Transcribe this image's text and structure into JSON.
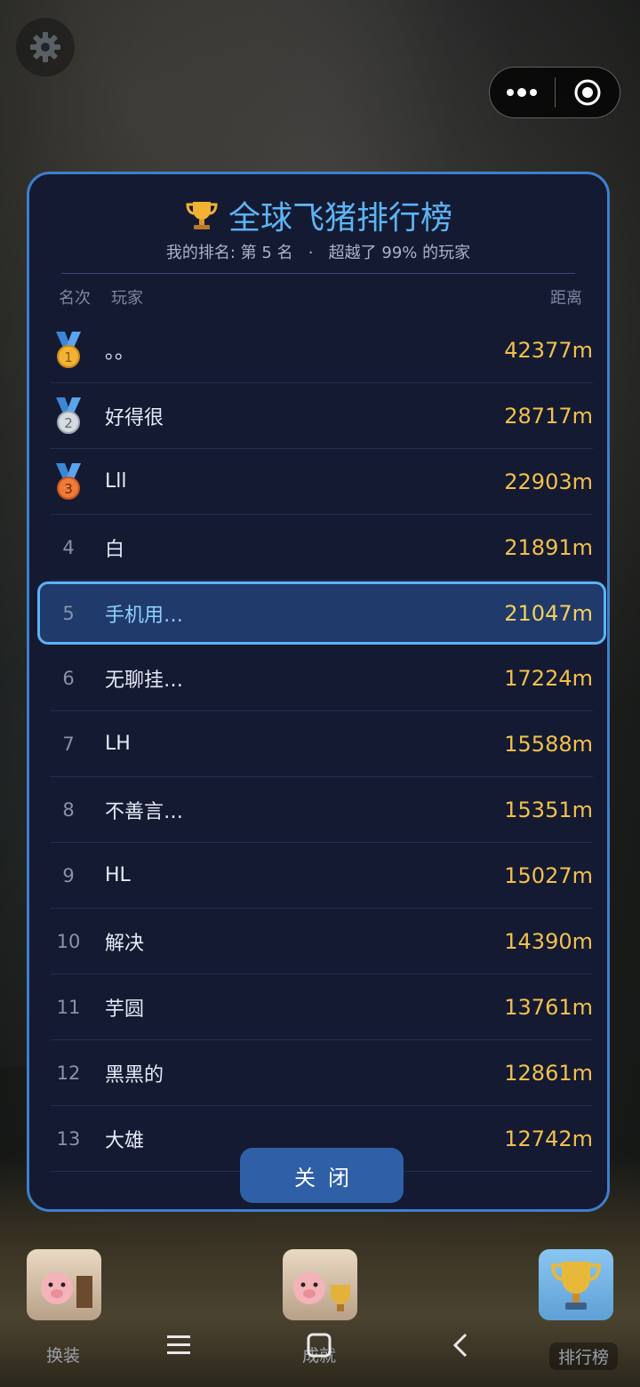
{
  "panel": {
    "title": "全球飞猪排行榜",
    "subtitle_prefix": "我的排名: 第 5 名",
    "subtitle_dot": "·",
    "subtitle_suffix": "超越了 99% 的玩家",
    "header": {
      "rank": "名次",
      "player": "玩家",
      "distance": "距离"
    },
    "rows": [
      {
        "rank": "1",
        "name": "。。",
        "distance": "42377m",
        "medal": "gold"
      },
      {
        "rank": "2",
        "name": "好得很",
        "distance": "28717m",
        "medal": "silver"
      },
      {
        "rank": "3",
        "name": "Lll",
        "distance": "22903m",
        "medal": "bronze"
      },
      {
        "rank": "4",
        "name": "白",
        "distance": "21891m"
      },
      {
        "rank": "5",
        "name": "手机用…",
        "distance": "21047m",
        "is_me": true
      },
      {
        "rank": "6",
        "name": "无聊挂…",
        "distance": "17224m"
      },
      {
        "rank": "7",
        "name": "LH",
        "distance": "15588m"
      },
      {
        "rank": "8",
        "name": "不善言…",
        "distance": "15351m"
      },
      {
        "rank": "9",
        "name": "HL",
        "distance": "15027m"
      },
      {
        "rank": "10",
        "name": "解决",
        "distance": "14390m"
      },
      {
        "rank": "11",
        "name": "芋圆",
        "distance": "13761m"
      },
      {
        "rank": "12",
        "name": "黑黑的",
        "distance": "12861m"
      },
      {
        "rank": "13",
        "name": "大雄",
        "distance": "12742m"
      }
    ],
    "close_label": "关闭"
  },
  "bottom_bar": {
    "left_label": "换装",
    "middle_label": "成就",
    "right_label": "排行榜"
  },
  "colors": {
    "accent": "#5cb4f4",
    "distance": "#f2c04c",
    "panel_bg": "#141a32",
    "highlight": "#1f3a6b"
  }
}
